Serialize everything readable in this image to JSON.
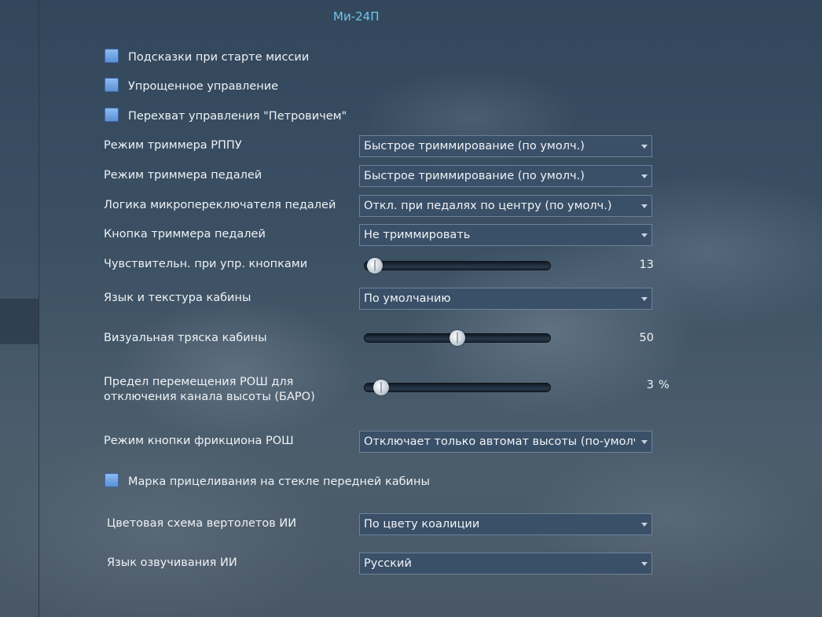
{
  "title": "Ми-24П",
  "checkboxes": [
    {
      "label": "Подсказки при старте миссии"
    },
    {
      "label": "Упрощенное управление"
    },
    {
      "label": "Перехват управления \"Петровичем\""
    },
    {
      "label": "Марка прицеливания на стекле передней кабины"
    }
  ],
  "settings": {
    "trimmer_rppu": {
      "label": "Режим триммера РППУ",
      "value": "Быстрое триммирование (по умолч.)"
    },
    "trimmer_pedals": {
      "label": "Режим триммера педалей",
      "value": "Быстрое триммирование (по умолч.)"
    },
    "microswitch_logic": {
      "label": "Логика микропереключателя педалей",
      "value": "Откл. при педалях по центру (по умолч.)"
    },
    "pedal_trimmer_button": {
      "label": "Кнопка триммера педалей",
      "value": "Не триммировать"
    },
    "button_sensitivity": {
      "label": "Чувствительн. при упр. кнопками",
      "value": "13",
      "level": 0.055
    },
    "cockpit_language": {
      "label": "Язык и текстура кабины",
      "value": "По умолчанию"
    },
    "cockpit_shake": {
      "label": "Визуальная тряска кабины",
      "value": "50",
      "level": 0.5
    },
    "rosh_limit": {
      "label_line1": "Предел перемещения РОШ для",
      "label_line2": "отключения канала высоты (БАРО)",
      "value": "3",
      "unit": "%",
      "level": 0.09
    },
    "friction_button": {
      "label": "Режим кнопки фрикциона РОШ",
      "value": "Отключает только автомат высоты (по-умолч"
    },
    "ai_color_scheme": {
      "label": "Цветовая схема вертолетов ИИ",
      "value": "По цвету коалиции"
    },
    "ai_voice_language": {
      "label": "Язык озвучивания ИИ",
      "value": "Русский"
    }
  },
  "icons": {
    "dropdown": "chevron-down-icon"
  },
  "colors": {
    "title": "#6fc6ec",
    "checkbox": "#7aa8e6",
    "select_bg": "#3a5068"
  }
}
